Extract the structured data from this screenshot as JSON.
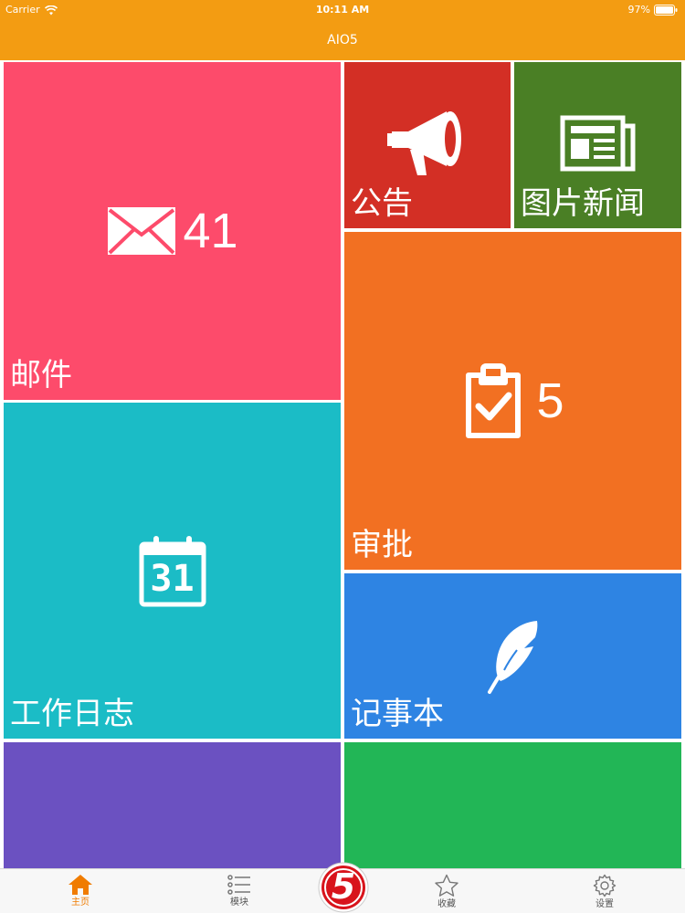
{
  "status_bar": {
    "carrier": "Carrier",
    "time": "10:11 AM",
    "battery": "97%"
  },
  "nav": {
    "title": "AIO5"
  },
  "colors": {
    "nav_bg": "#f39c12",
    "mail": "#fd4b6b",
    "notice": "#d32f25",
    "news": "#4a7f25",
    "approval": "#f27022",
    "worklog": "#1bbcc6",
    "notepad": "#2e84e3",
    "purple_tile": "#6b51c1",
    "green_tile": "#22b656",
    "tab_active": "#f07c00"
  },
  "tiles": {
    "mail": {
      "label": "邮件",
      "count": "41",
      "icon": "envelope-icon"
    },
    "notice": {
      "label": "公告",
      "icon": "megaphone-icon"
    },
    "news": {
      "label": "图片新闻",
      "icon": "newspaper-icon"
    },
    "approval": {
      "label": "审批",
      "count": "5",
      "icon": "clipboard-check-icon"
    },
    "worklog": {
      "label": "工作日志",
      "icon": "calendar-icon",
      "calendar_day": "31"
    },
    "notepad": {
      "label": "记事本",
      "icon": "feather-icon"
    }
  },
  "tabbar": {
    "home": {
      "label": "主页",
      "icon": "home-icon",
      "active": true
    },
    "modules": {
      "label": "模块",
      "icon": "list-icon"
    },
    "center": {
      "badge": "5",
      "icon": "app-logo-icon"
    },
    "favs": {
      "label": "收藏",
      "icon": "star-icon"
    },
    "settings": {
      "label": "设置",
      "icon": "gear-icon"
    }
  }
}
